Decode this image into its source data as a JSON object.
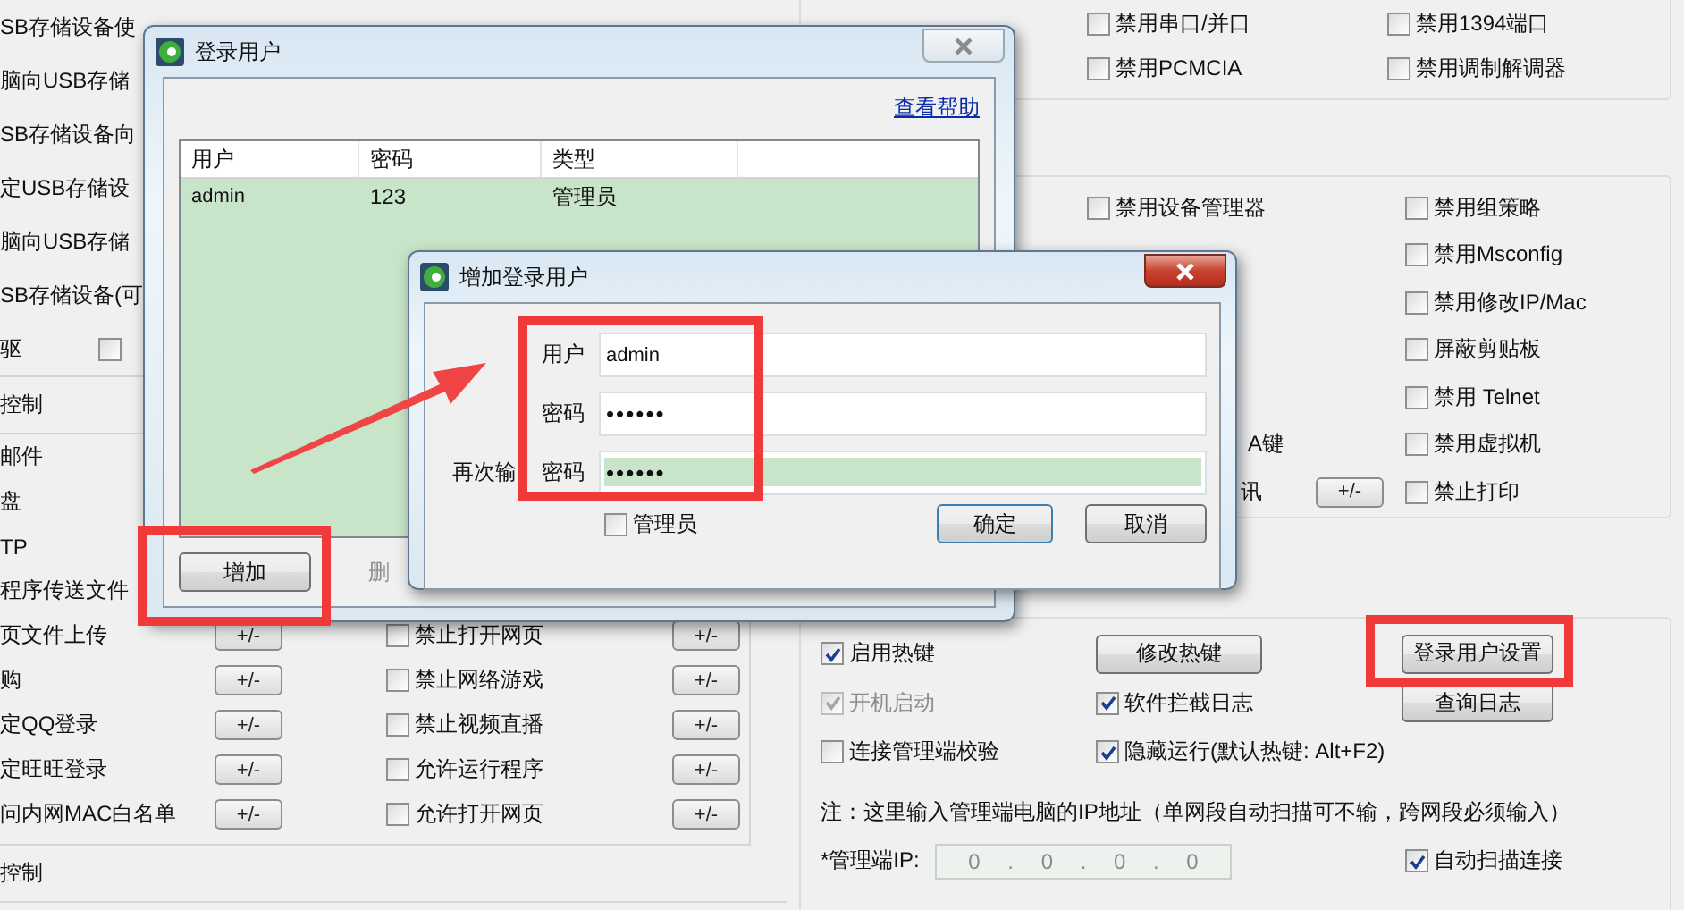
{
  "left_panel": {
    "usb_rows": [
      "SB存储设备使",
      "脑向USB存储",
      "SB存储设备向",
      "定USB存储设",
      "脑向USB存储",
      "SB存储设备(可"
    ],
    "optical_row": {
      "label": "驱",
      "checkbox": {
        "checked": false
      }
    },
    "section_title": "控制",
    "rows": [
      {
        "label": "邮件"
      },
      {
        "label": "盘"
      },
      {
        "label": "TP"
      },
      {
        "label": "程序传送文件"
      },
      {
        "label": "页文件上传",
        "button": "+/-"
      },
      {
        "label": "购",
        "button": "+/-"
      },
      {
        "label": "定QQ登录",
        "button": "+/-"
      },
      {
        "label": "定旺旺登录",
        "button": "+/-"
      },
      {
        "label": "问内网MAC白名单",
        "button": "+/-"
      }
    ],
    "web_rows": [
      {
        "label": "禁止打开网页",
        "checked": false,
        "button": "+/-"
      },
      {
        "label": "禁止网络游戏",
        "checked": false,
        "button": "+/-"
      },
      {
        "label": "禁止视频直播",
        "checked": false,
        "button": "+/-"
      },
      {
        "label": "允许运行程序",
        "checked": false,
        "button": "+/-"
      },
      {
        "label": "允许打开网页",
        "checked": false,
        "button": "+/-"
      }
    ],
    "footer_title": "控制"
  },
  "right_panel": {
    "ports": [
      {
        "label": "禁用串口/并口",
        "checked": false
      },
      {
        "label": "禁用1394端口",
        "checked": false
      },
      {
        "label": "禁用PCMCIA",
        "checked": false
      },
      {
        "label": "禁用调制解调器",
        "checked": false
      }
    ],
    "system_left": {
      "first": {
        "label": "禁用设备管理器",
        "checked": false
      },
      "partial": [
        "A键",
        "讯"
      ],
      "button": "+/-"
    },
    "system_right": [
      {
        "label": "禁用组策略",
        "checked": false
      },
      {
        "label": "禁用Msconfig",
        "checked": false
      },
      {
        "label": "禁用修改IP/Mac",
        "checked": false
      },
      {
        "label": "屏蔽剪贴板",
        "checked": false
      },
      {
        "label": "禁用 Telnet",
        "checked": false
      },
      {
        "label": "禁用虚拟机",
        "checked": false
      },
      {
        "label": "禁止打印",
        "checked": false
      }
    ],
    "options": [
      {
        "label": "启用热键",
        "checked": true,
        "disabled": false
      },
      {
        "label": "开机启动",
        "checked": true,
        "disabled": true
      },
      {
        "label": "连接管理端校验",
        "checked": false,
        "disabled": false
      }
    ],
    "options_2": [
      {
        "label": "软件拦截日志",
        "checked": true
      },
      {
        "label": "隐藏运行(默认热键: Alt+F2)",
        "checked": true
      }
    ],
    "buttons": {
      "modify_hotkey": "修改热键",
      "login_users": "登录用户设置",
      "query_log": "查询日志"
    },
    "note": "注：这里输入管理端电脑的IP地址（单网段自动扫描可不输，跨网段必须输入）",
    "server_ip": {
      "label": "*管理端IP:",
      "octets": [
        "0",
        "0",
        "0",
        "0"
      ],
      "separator": ".",
      "disabled": true
    },
    "auto_scan": {
      "label": "自动扫描连接",
      "checked": true
    }
  },
  "login_dialog": {
    "title": "登录用户",
    "help_link": "查看帮助",
    "columns": [
      "用户",
      "密码",
      "类型"
    ],
    "rows": [
      [
        "admin",
        "123",
        "管理员"
      ]
    ],
    "buttons": [
      "增加",
      "删"
    ]
  },
  "add_dialog": {
    "title": "增加登录用户",
    "fields": [
      {
        "label": "用户",
        "value": "admin",
        "highlighted": false
      },
      {
        "label": "密码",
        "value": "••••••",
        "highlighted": false
      },
      {
        "prefix": "再次输",
        "label": "密码",
        "value": "••••••",
        "highlighted": true
      }
    ],
    "admin_checkbox": {
      "label": "管理员",
      "checked": false
    },
    "ok": "确定",
    "cancel": "取消"
  }
}
